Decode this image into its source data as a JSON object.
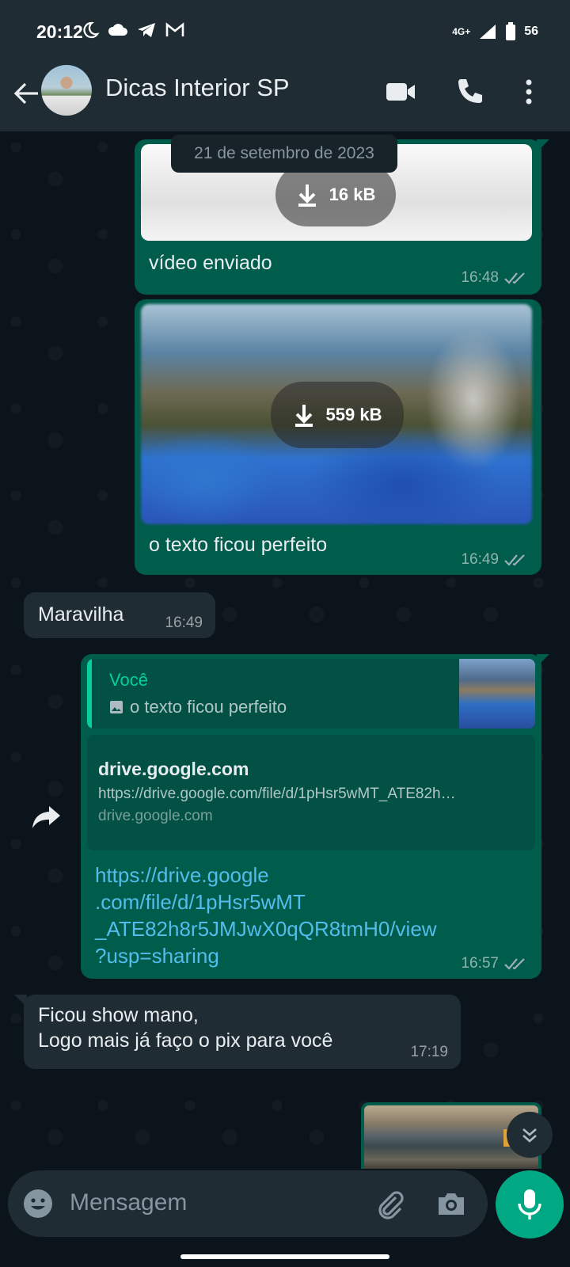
{
  "status_bar": {
    "time": "20:12",
    "network": "4G+",
    "battery": "56",
    "icons": [
      "moon-icon",
      "cloud-icon",
      "telegram-icon",
      "gmail-icon",
      "signal-icon",
      "battery-icon"
    ]
  },
  "header": {
    "contact_name": "Dicas Interior SP",
    "icons": [
      "back-arrow-icon",
      "video-call-icon",
      "phone-icon",
      "more-options-icon"
    ]
  },
  "chat": {
    "date_chip": "21 de setembro de 2023",
    "messages": [
      {
        "direction": "out",
        "type": "video",
        "download_size": "16 kB",
        "caption": "vídeo enviado",
        "time": "16:48",
        "status": "read"
      },
      {
        "direction": "out",
        "type": "image",
        "download_size": "559 kB",
        "caption": "o texto ficou perfeito",
        "time": "16:49",
        "status": "read"
      },
      {
        "direction": "in",
        "type": "text",
        "text": "Maravilha",
        "time": "16:49"
      },
      {
        "direction": "out",
        "type": "link_reply",
        "quote_author": "Você",
        "quote_text": "o texto ficou perfeito",
        "preview_domain": "drive.google.com",
        "preview_url": "https://drive.google.com/file/d/1pHsr5wMT_ATE82h…",
        "preview_site": "drive.google.com",
        "link_lines": [
          "https://drive.google",
          ".com/file/d/1pHsr5wMT",
          "_ATE82h8r5JMJwX0qQR8tmH0/view",
          "?usp=sharing"
        ],
        "time": "16:57",
        "status": "read"
      },
      {
        "direction": "in",
        "type": "text",
        "lines": [
          "Ficou show mano,",
          "Logo mais já faço o pix para você"
        ],
        "time": "17:19"
      }
    ]
  },
  "composer": {
    "placeholder": "Mensagem"
  },
  "colors": {
    "outgoing_bubble": "#005c4b",
    "incoming_bubble": "#1f2c34",
    "accent": "#00a884",
    "link": "#53bdeb",
    "background": "#0b141a"
  }
}
